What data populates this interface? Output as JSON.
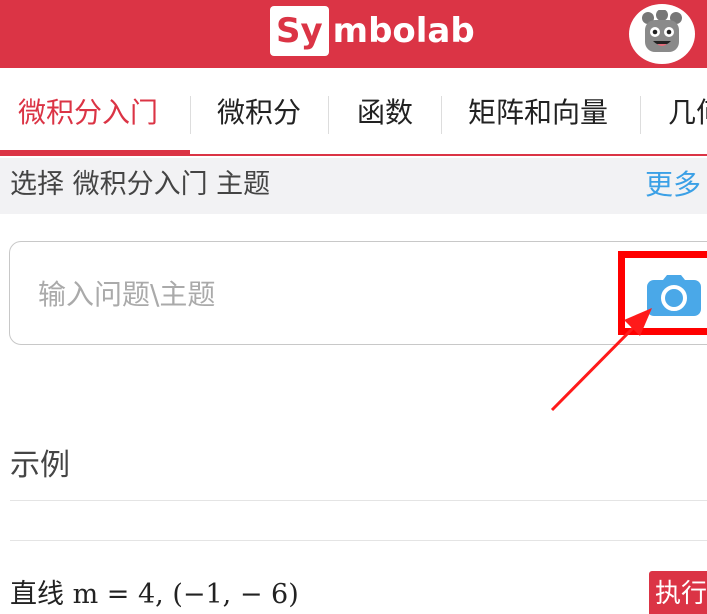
{
  "header": {
    "logo_box_text": "Sy",
    "logo_rest_text": "mbolab",
    "brand_color": "#db3445"
  },
  "tabs": [
    {
      "label": "微积分入门",
      "active": true
    },
    {
      "label": "微积分",
      "active": false
    },
    {
      "label": "函数",
      "active": false
    },
    {
      "label": "矩阵和向量",
      "active": false
    },
    {
      "label": "几何",
      "active": false
    }
  ],
  "topic_bar": {
    "title": "选择 微积分入门 主题",
    "more_label": "更多"
  },
  "search": {
    "placeholder": "输入问题\\主题",
    "value": ""
  },
  "annotation": {
    "highlight_color": "#ff0000"
  },
  "examples": {
    "title": "示例",
    "items": [
      {
        "label": "直线",
        "math": "m = 4, (−1, − 6)",
        "action_label": "执行"
      }
    ]
  },
  "icons": {
    "avatar": "robot-avatar-icon",
    "camera": "camera-icon"
  }
}
